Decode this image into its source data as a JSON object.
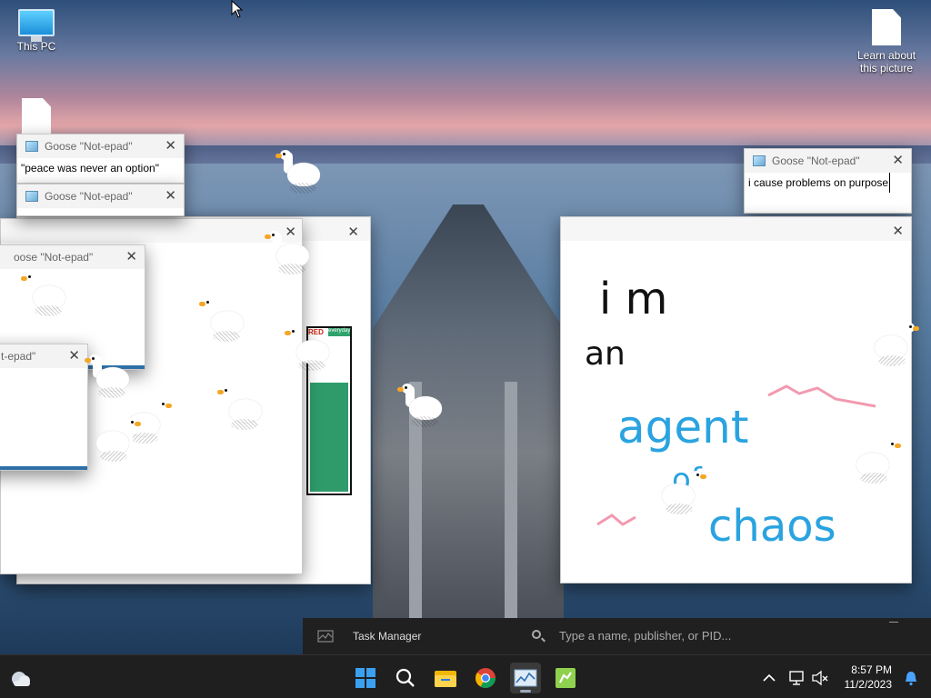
{
  "desktop": {
    "icons": [
      {
        "label": "This PC",
        "icon": "this-pc-icon"
      },
      {
        "label": "Learn about this picture",
        "icon": "document-icon"
      },
      {
        "label": "",
        "icon": "document-icon"
      }
    ]
  },
  "notepad_windows": [
    {
      "title": "Goose \"Not-epad\"",
      "text": "\"peace was never an option\""
    },
    {
      "title": "Goose \"Not-epad\"",
      "text": ""
    },
    {
      "title": "Goose \"Not-epad\"",
      "text": "i cause problems on purpose"
    },
    {
      "title": "oose \"Not-epad\"",
      "text": ""
    },
    {
      "title": "t-epad\"",
      "text": ""
    }
  ],
  "drawing": {
    "lines": [
      "i m",
      "an",
      "agent",
      "of",
      "chaos"
    ]
  },
  "comic": {
    "badge": "RED",
    "badge2": "everyday"
  },
  "task_manager": {
    "label": "Task Manager",
    "search_placeholder": "Type a name, publisher, or PID..."
  },
  "taskbar": {
    "apps": [
      "start-icon",
      "search-icon",
      "file-explorer-icon",
      "chrome-icon",
      "task-manager-icon",
      "goose-app-icon"
    ],
    "time": "8:57 PM",
    "date": "11/2/2023"
  },
  "colors": {
    "accent": "#2e6fa8",
    "taskbar": "#1f1f1f",
    "drawing_blue": "#2aa3e0",
    "drawing_pink": "#f19ab0"
  }
}
